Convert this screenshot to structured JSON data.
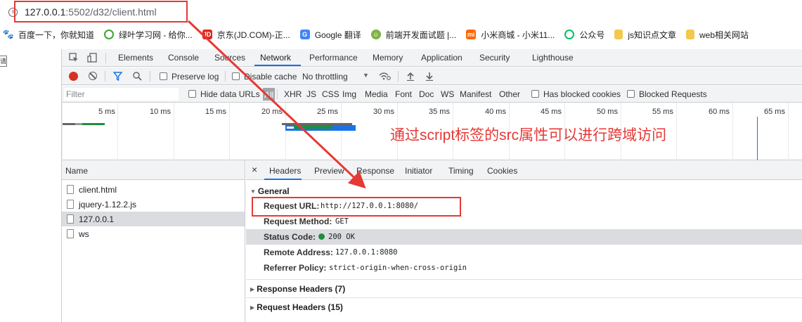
{
  "address_bar": {
    "url_host": "127.0.0.1",
    "url_rest": ":5502/d32/client.html"
  },
  "bookmarks": [
    {
      "label": "百度一下，你就知道",
      "icon": "baidu-paw-icon",
      "color": "#2932e1"
    },
    {
      "label": "绿叶学习网 - 给你...",
      "icon": "leaf-icon",
      "color": "#3fa534"
    },
    {
      "label": "京东(JD.COM)-正...",
      "icon": "jd-icon",
      "color": "#e1251b"
    },
    {
      "label": "Google 翻译",
      "icon": "translate-icon",
      "color": "#4285f4"
    },
    {
      "label": "前端开发面试题 |...",
      "icon": "smile-icon",
      "color": "#7cb342"
    },
    {
      "label": "小米商城 - 小米11...",
      "icon": "mi-icon",
      "color": "#ff6700"
    },
    {
      "label": "公众号",
      "icon": "wechat-icon",
      "color": "#07c160"
    },
    {
      "label": "js知识点文章",
      "icon": "folder-icon",
      "color": "#f2c94c"
    },
    {
      "label": "web相关网站",
      "icon": "folder-icon",
      "color": "#f2c94c"
    }
  ],
  "left_strip": {
    "chip": "请"
  },
  "devtools": {
    "panel_tabs": [
      "Elements",
      "Console",
      "Sources",
      "Network",
      "Performance",
      "Memory",
      "Application",
      "Security",
      "Lighthouse"
    ],
    "active_tab": "Network",
    "toolbar": {
      "preserve_log": "Preserve log",
      "disable_cache": "Disable cache",
      "throttling": "No throttling"
    },
    "filter": {
      "placeholder": "Filter",
      "hide_data_urls": "Hide data URLs",
      "all": "All",
      "types": [
        "XHR",
        "JS",
        "CSS",
        "Img",
        "Media",
        "Font",
        "Doc",
        "WS",
        "Manifest",
        "Other"
      ],
      "has_blocked_cookies": "Has blocked cookies",
      "blocked_requests": "Blocked Requests"
    },
    "timeline_ticks": [
      "5 ms",
      "10 ms",
      "15 ms",
      "20 ms",
      "25 ms",
      "30 ms",
      "35 ms",
      "40 ms",
      "45 ms",
      "50 ms",
      "55 ms",
      "60 ms",
      "65 ms"
    ],
    "request_list": {
      "header": "Name",
      "rows": [
        "client.html",
        "jquery-1.12.2.js",
        "127.0.0.1",
        "ws"
      ],
      "selected": "127.0.0.1"
    },
    "detail": {
      "close": "×",
      "tabs": [
        "Headers",
        "Preview",
        "Response",
        "Initiator",
        "Timing",
        "Cookies"
      ],
      "active_tab": "Headers",
      "general_title": "General",
      "general": [
        {
          "key": "Request URL:",
          "value": "http://127.0.0.1:8080/"
        },
        {
          "key": "Request Method:",
          "value": "GET"
        },
        {
          "key": "Status Code:",
          "value": "200 OK"
        },
        {
          "key": "Remote Address:",
          "value": "127.0.0.1:8080"
        },
        {
          "key": "Referrer Policy:",
          "value": "strict-origin-when-cross-origin"
        }
      ],
      "response_headers": "Response Headers (7)",
      "request_headers": "Request Headers (15)"
    }
  },
  "annotation": {
    "text": "通过script标签的src属性可以进行跨域访问",
    "color": "#e53935"
  }
}
